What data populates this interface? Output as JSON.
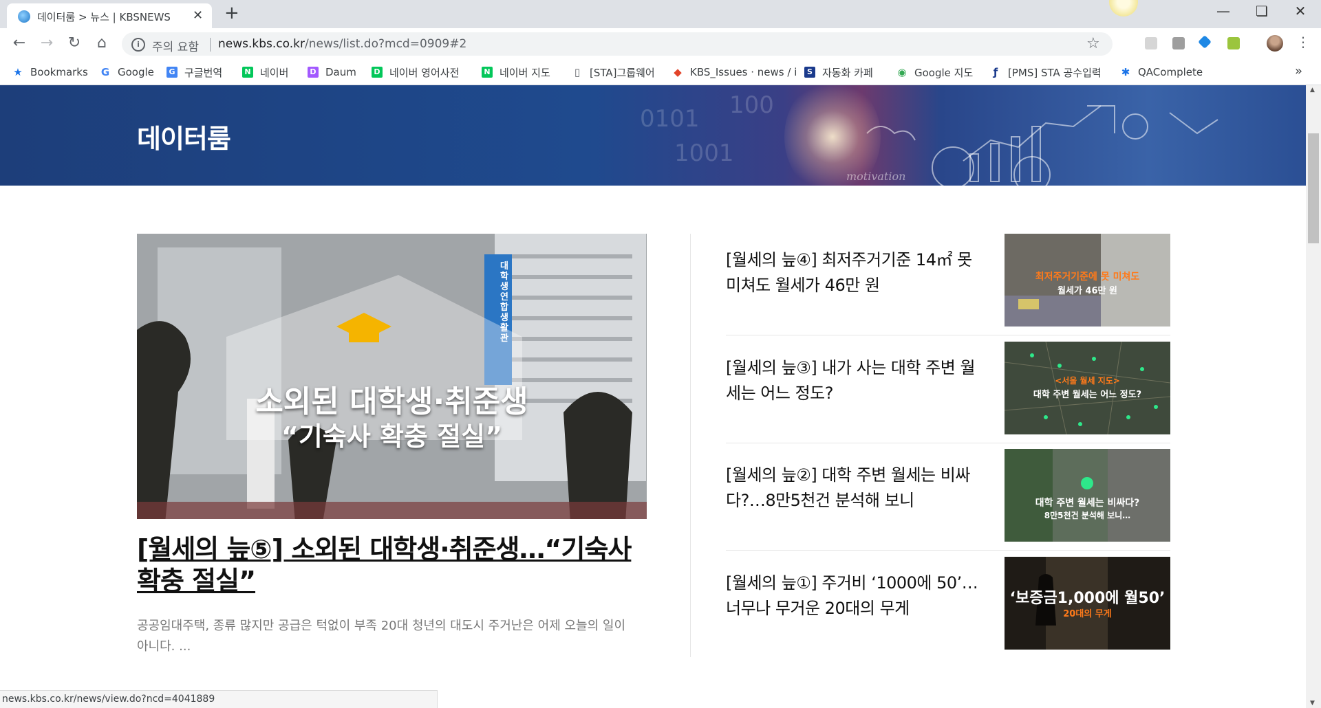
{
  "browser": {
    "tab_title": "데이터룸 > 뉴스 | KBSNEWS",
    "tab_close": "✕",
    "new_tab": "+",
    "security_label": "주의 요함",
    "url_host": "news.kbs.co.kr",
    "url_path": "/news/list.do?mcd=0909#2",
    "bookmarks": [
      {
        "label": "Bookmarks",
        "icon": "star-icon",
        "color": "#1a73e8"
      },
      {
        "label": "Google",
        "icon": "google-icon",
        "color": "#4285f4"
      },
      {
        "label": "구글번역",
        "icon": "translate-icon",
        "color": "#4285f4"
      },
      {
        "label": "네이버",
        "icon": "naver-icon",
        "color": "#03c75a"
      },
      {
        "label": "Daum",
        "icon": "daum-icon",
        "color": "#a259ff"
      },
      {
        "label": "네이버 영어사전",
        "icon": "naver-dict-icon",
        "color": "#03c75a"
      },
      {
        "label": "네이버 지도",
        "icon": "naver-map-icon",
        "color": "#03c75a"
      },
      {
        "label": "[STA]그룹웨어",
        "icon": "page-icon",
        "color": "#5f6368"
      },
      {
        "label": "KBS_Issues · news / i",
        "icon": "gitlab-icon",
        "color": "#e24329"
      },
      {
        "label": "자동화 카페",
        "icon": "sta-icon",
        "color": "#1a3a8c"
      },
      {
        "label": "Google 지도",
        "icon": "google-maps-icon",
        "color": "#34a853"
      },
      {
        "label": "[PMS] STA 공수입력",
        "icon": "pms-icon",
        "color": "#1a3a8c"
      },
      {
        "label": "QAComplete",
        "icon": "qacomplete-icon",
        "color": "#1a73e8"
      }
    ],
    "bookmarks_more": "»"
  },
  "page": {
    "banner_title": "데이터룸",
    "featured": {
      "title": "[월세의 늪⑤] 소외된 대학생·취준생…“기숙사 확충 절실”",
      "description": "공공임대주택, 종류 많지만 공급은 턱없이 부족 20대 청년의 대도시 주거난은 어제 오늘의 일이 아니다. ...",
      "image_caption_line1": "소외된 대학생·취준생",
      "image_caption_line2": "“기숙사 확충 절실”",
      "image_sign": "대학생 연합생활관"
    },
    "items": [
      {
        "title": "[월세의 늪④] 최저주거기준 14㎡ 못 미쳐도 월세가 46만 원",
        "thumb_line1": "최저주거기준에 못 미쳐도",
        "thumb_line2": "월세가 46만 원"
      },
      {
        "title": "[월세의 늪③] 내가 사는 대학 주변 월세는 어느 정도?",
        "thumb_line1": "<서울 월세 지도>",
        "thumb_line2": "대학 주변 월세는 어느 정도?"
      },
      {
        "title": "[월세의 늪②] 대학 주변 월세는 비싸다?…8만5천건 분석해 보니",
        "thumb_line1": "대학 주변 월세는 비싸다?",
        "thumb_line2": "8만5천건 분석해 보니…"
      },
      {
        "title": "[월세의 늪①] 주거비 ‘1000에 50’…너무나 무거운 20대의 무게",
        "thumb_line1": "‘보증금1,000에 월50’",
        "thumb_line2": "20대의 무게"
      }
    ]
  },
  "status_url": "news.kbs.co.kr/news/view.do?ncd=4041889",
  "colors": {
    "banner": "#1f4a8e",
    "accent_yellow": "#f5b400",
    "thumb_orange": "#ff7a1a"
  }
}
